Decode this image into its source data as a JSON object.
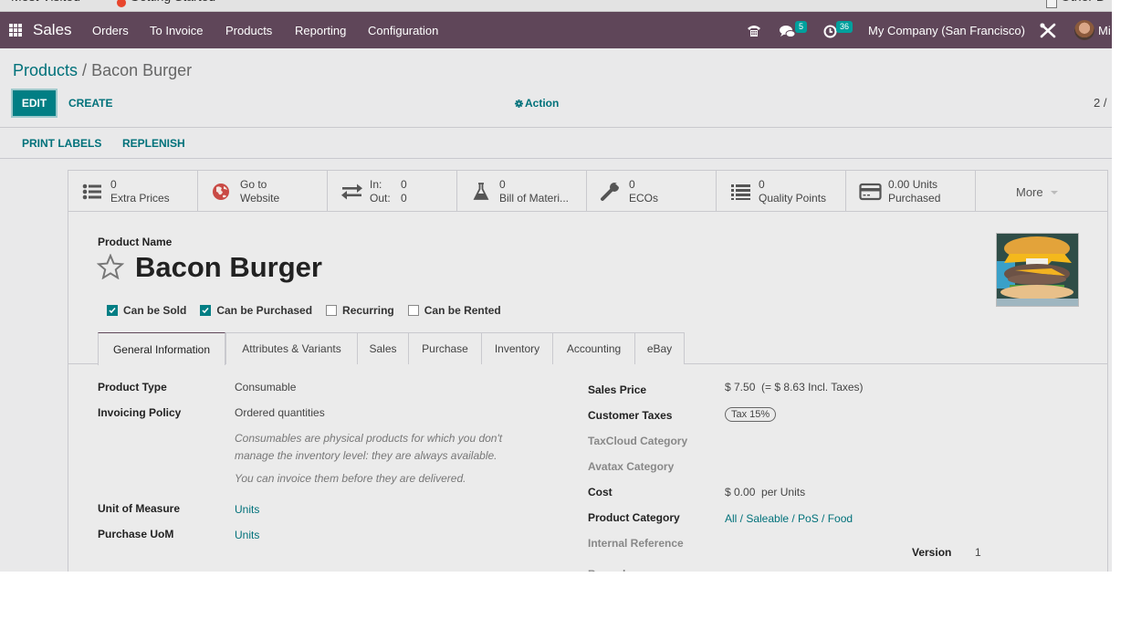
{
  "browser": {
    "bookmarks": [
      {
        "label": "Most Visited",
        "icon": "gear-icon"
      },
      {
        "label": "Getting Started",
        "icon": "firefox-icon"
      },
      {
        "label": "Other B",
        "icon": "folder-icon"
      }
    ]
  },
  "navbar": {
    "app_name": "Sales",
    "menu": [
      "Orders",
      "To Invoice",
      "Products",
      "Reporting",
      "Configuration"
    ],
    "systray": {
      "phone_icon": "phone-icon",
      "messages_count": "5",
      "activities_count": "36",
      "company": "My Company (San Francisco)",
      "debug_icon": "tools-icon",
      "user_name": "Mi"
    },
    "colors": {
      "bar": "#5f4659",
      "badge": "#00a09d"
    }
  },
  "control_panel": {
    "breadcrumb_parent": "Products",
    "breadcrumb_separator": " / ",
    "breadcrumb_current": "Bacon Burger",
    "edit_label": "EDIT",
    "create_label": "CREATE",
    "action_label": "Action",
    "pager": "2 / "
  },
  "header_buttons": [
    "PRINT LABELS",
    "REPLENISH"
  ],
  "smart_buttons": [
    {
      "icon": "list-icon",
      "line1": "0",
      "line2": "Extra Prices"
    },
    {
      "icon": "globe-icon",
      "line1": "Go to",
      "line2": "Website"
    },
    {
      "icon": "exchange-icon",
      "line1": "In:",
      "line2": "Out:",
      "in_value": "0",
      "out_value": "0"
    },
    {
      "icon": "flask-icon",
      "line1": "0",
      "line2": "Bill of Materi..."
    },
    {
      "icon": "wrench-icon",
      "line1": "0",
      "line2": "ECOs"
    },
    {
      "icon": "list-icon",
      "line1": "0",
      "line2": "Quality Points"
    },
    {
      "icon": "credit-card-icon",
      "line1": "0.00 Units",
      "line2": "Purchased"
    }
  ],
  "more_label": "More",
  "product": {
    "name_label": "Product Name",
    "name": "Bacon Burger",
    "favorite": false,
    "checkboxes": [
      {
        "label": "Can be Sold",
        "checked": true
      },
      {
        "label": "Can be Purchased",
        "checked": true
      },
      {
        "label": "Recurring",
        "checked": false
      },
      {
        "label": "Can be Rented",
        "checked": false
      }
    ]
  },
  "tabs": [
    "General Information",
    "Attributes & Variants",
    "Sales",
    "Purchase",
    "Inventory",
    "Accounting",
    "eBay"
  ],
  "active_tab": "General Information",
  "general": {
    "left": {
      "product_type_label": "Product Type",
      "product_type": "Consumable",
      "invoicing_policy_label": "Invoicing Policy",
      "invoicing_policy": "Ordered quantities",
      "help_text_1": "Consumables are physical products for which you don't manage the inventory level: they are always available.",
      "help_text_2": "You can invoice them before they are delivered.",
      "uom_label": "Unit of Measure",
      "uom": "Units",
      "purchase_uom_label": "Purchase UoM",
      "purchase_uom": "Units"
    },
    "right": {
      "sales_price_label": "Sales Price",
      "sales_price": "$ 7.50",
      "sales_price_incl": "(= $ 8.63 Incl. Taxes)",
      "customer_taxes_label": "Customer Taxes",
      "customer_tax_tag": "Tax 15%",
      "taxcloud_label": "TaxCloud Category",
      "avatax_label": "Avatax Category",
      "cost_label": "Cost",
      "cost": "$ 0.00",
      "cost_unit": "per Units",
      "category_label": "Product Category",
      "category": "All / Saleable / PoS / Food",
      "internal_ref_label": "Internal Reference",
      "barcode_label": "Barcode",
      "version_label": "Version",
      "version": "1"
    }
  }
}
